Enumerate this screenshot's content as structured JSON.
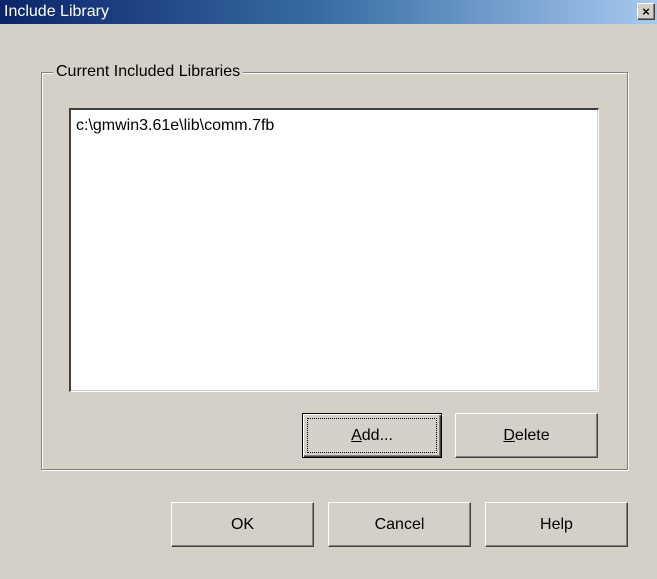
{
  "window": {
    "title": "Include Library",
    "close_glyph": "×"
  },
  "group": {
    "label": "Current Included Libraries"
  },
  "library_list": {
    "items": [
      "c:\\gmwin3.61e\\lib\\comm.7fb"
    ]
  },
  "buttons": {
    "add": {
      "mnemonic": "A",
      "rest": "dd..."
    },
    "delete": {
      "mnemonic": "D",
      "rest": "elete"
    },
    "ok": "OK",
    "cancel": "Cancel",
    "help": "Help"
  },
  "colors": {
    "face": "#d4d0c8",
    "title_start": "#0a246a",
    "title_end": "#a6caf0"
  }
}
